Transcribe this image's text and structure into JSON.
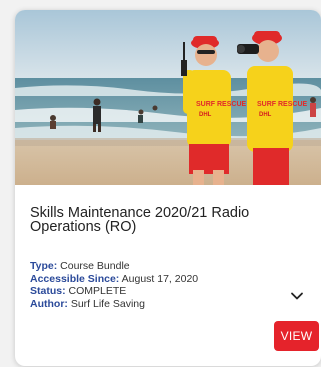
{
  "card": {
    "image_alt": "Surf lifesavers watching the beach",
    "title": "Skills Maintenance 2020/21 Radio Operations (RO)",
    "details": [
      {
        "key": "Type:",
        "value": "Course Bundle"
      },
      {
        "key": "Accessible Since:",
        "value": "August 17, 2020"
      },
      {
        "key": "Status:",
        "value": "COMPLETE"
      },
      {
        "key": "Author:",
        "value": "Surf Life Saving"
      }
    ],
    "expand_icon": "chevron-down-icon",
    "view_label": "VIEW"
  },
  "colors": {
    "accent": "#e5232b",
    "label": "#2b4a9a"
  }
}
